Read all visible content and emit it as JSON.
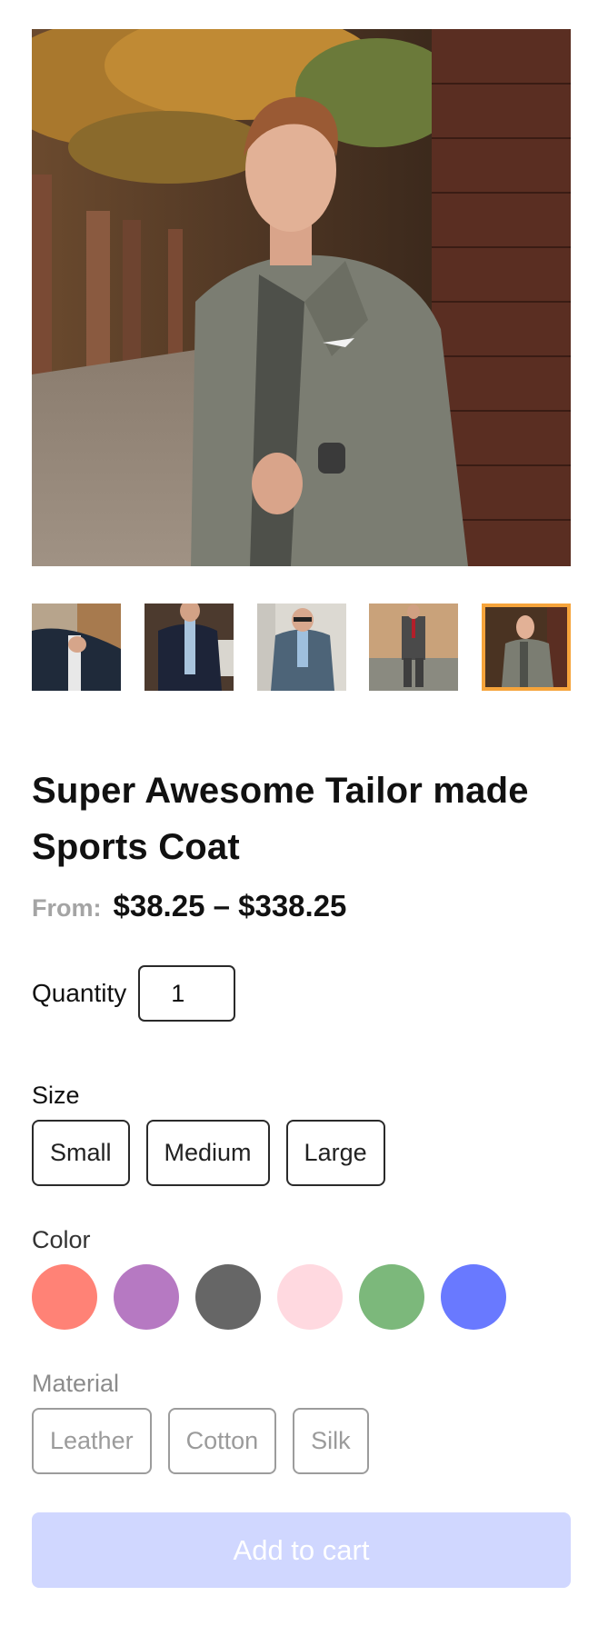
{
  "product": {
    "title": "Super Awesome Tailor made Sports Coat",
    "price_from_label": "From:",
    "price_range": "$38.25 – $338.25"
  },
  "gallery": {
    "main_image_icon": "man-in-grey-sports-coat-photo",
    "thumbnails": [
      {
        "icon": "man-adjusting-navy-jacket-photo",
        "active": false
      },
      {
        "icon": "man-in-navy-suit-photo",
        "active": false
      },
      {
        "icon": "man-in-blue-suit-sunglasses-photo",
        "active": false
      },
      {
        "icon": "man-in-grey-suit-field-photo",
        "active": false
      },
      {
        "icon": "man-in-grey-sports-coat-photo",
        "active": true
      }
    ]
  },
  "quantity": {
    "label": "Quantity",
    "value": "1"
  },
  "size": {
    "label": "Size",
    "options": [
      "Small",
      "Medium",
      "Large"
    ]
  },
  "color": {
    "label": "Color",
    "swatches": [
      "#ff8276",
      "#b679c2",
      "#666666",
      "#ffd9e0",
      "#7cb87b",
      "#6979ff"
    ]
  },
  "material": {
    "label": "Material",
    "options": [
      "Leather",
      "Cotton",
      "Silk"
    ]
  },
  "cart": {
    "label": "Add to cart",
    "button_color": "#d0d7ff"
  },
  "accent": {
    "thumbnail_active_border": "#f6a43b"
  }
}
